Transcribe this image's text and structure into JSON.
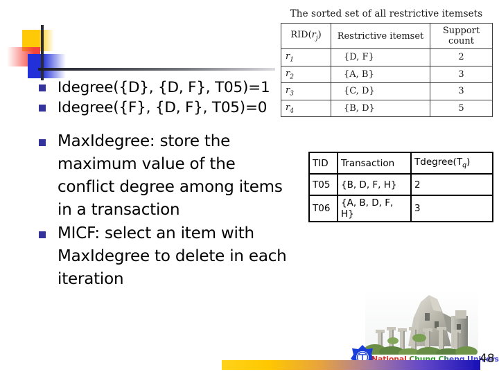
{
  "slide": {
    "page_number": "48"
  },
  "bullets": {
    "group_small": [
      "Idegree({D}, {D, F}, T05)=1",
      "Idegree({F}, {D, F}, T05)=0"
    ],
    "group_big": [
      "MaxIdegree: store the\nmaximum value of the\nconflict degree among items\nin a transaction",
      "MICF: select an item with\nMaxIdegree to delete in each\niteration"
    ]
  },
  "table_restrictive": {
    "title": "The sorted set of all restrictive itemsets",
    "headers": {
      "rid": "RID(",
      "rid_sub": "j",
      "rid_var": "r",
      "rid_close": ")",
      "itemset": "Restrictive itemset",
      "support": "Support count"
    },
    "rows": [
      {
        "rid": "r",
        "rid_sub": "1",
        "itemset": "{D, F}",
        "support": "2"
      },
      {
        "rid": "r",
        "rid_sub": "2",
        "itemset": "{A, B}",
        "support": "3"
      },
      {
        "rid": "r",
        "rid_sub": "3",
        "itemset": "{C, D}",
        "support": "3"
      },
      {
        "rid": "r",
        "rid_sub": "4",
        "itemset": "{B, D}",
        "support": "5"
      }
    ]
  },
  "table_transactions": {
    "headers": {
      "tid": "TID",
      "transaction": "Transaction",
      "tdegree": "Tdegree(T",
      "tdegree_sub": "q",
      "tdegree_close": ")"
    },
    "rows": [
      {
        "tid": "T05",
        "transaction": "{B, D, F, H}",
        "tdegree": "2"
      },
      {
        "tid": "T06",
        "transaction": "{A, B, D, F, H}",
        "tdegree": "3"
      }
    ]
  },
  "branding": {
    "university": "National Chung Cheng University"
  },
  "colors": {
    "bullet_marker": "#33339B",
    "deco_yellow": "#FFC907",
    "deco_red": "#F4433B",
    "deco_blue": "#2130D8",
    "footer_start": "#FFD21A",
    "footer_end": "#1B13B8"
  }
}
